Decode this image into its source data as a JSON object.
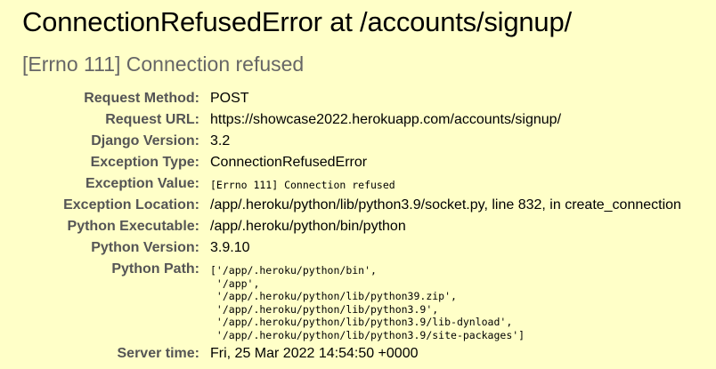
{
  "error": {
    "title": "ConnectionRefusedError at /accounts/signup/",
    "message": "[Errno 111] Connection refused"
  },
  "meta": {
    "request_method": {
      "label": "Request Method:",
      "value": "POST"
    },
    "request_url": {
      "label": "Request URL:",
      "value": "https://showcase2022.herokuapp.com/accounts/signup/"
    },
    "django_version": {
      "label": "Django Version:",
      "value": "3.2"
    },
    "exception_type": {
      "label": "Exception Type:",
      "value": "ConnectionRefusedError"
    },
    "exception_value": {
      "label": "Exception Value:",
      "value": "[Errno 111] Connection refused"
    },
    "exception_location": {
      "label": "Exception Location:",
      "value": "/app/.heroku/python/lib/python3.9/socket.py, line 832, in create_connection"
    },
    "python_executable": {
      "label": "Python Executable:",
      "value": "/app/.heroku/python/bin/python"
    },
    "python_version": {
      "label": "Python Version:",
      "value": "3.9.10"
    },
    "python_path": {
      "label": "Python Path:",
      "value": "['/app/.heroku/python/bin',\n '/app',\n '/app/.heroku/python/lib/python39.zip',\n '/app/.heroku/python/lib/python3.9',\n '/app/.heroku/python/lib/python3.9/lib-dynload',\n '/app/.heroku/python/lib/python3.9/site-packages']"
    },
    "server_time": {
      "label": "Server time:",
      "value": "Fri, 25 Mar 2022 14:54:50 +0000"
    }
  },
  "colors": {
    "background": "#ffffc8",
    "label": "#555555",
    "subtitle": "#666666",
    "text": "#000000"
  }
}
